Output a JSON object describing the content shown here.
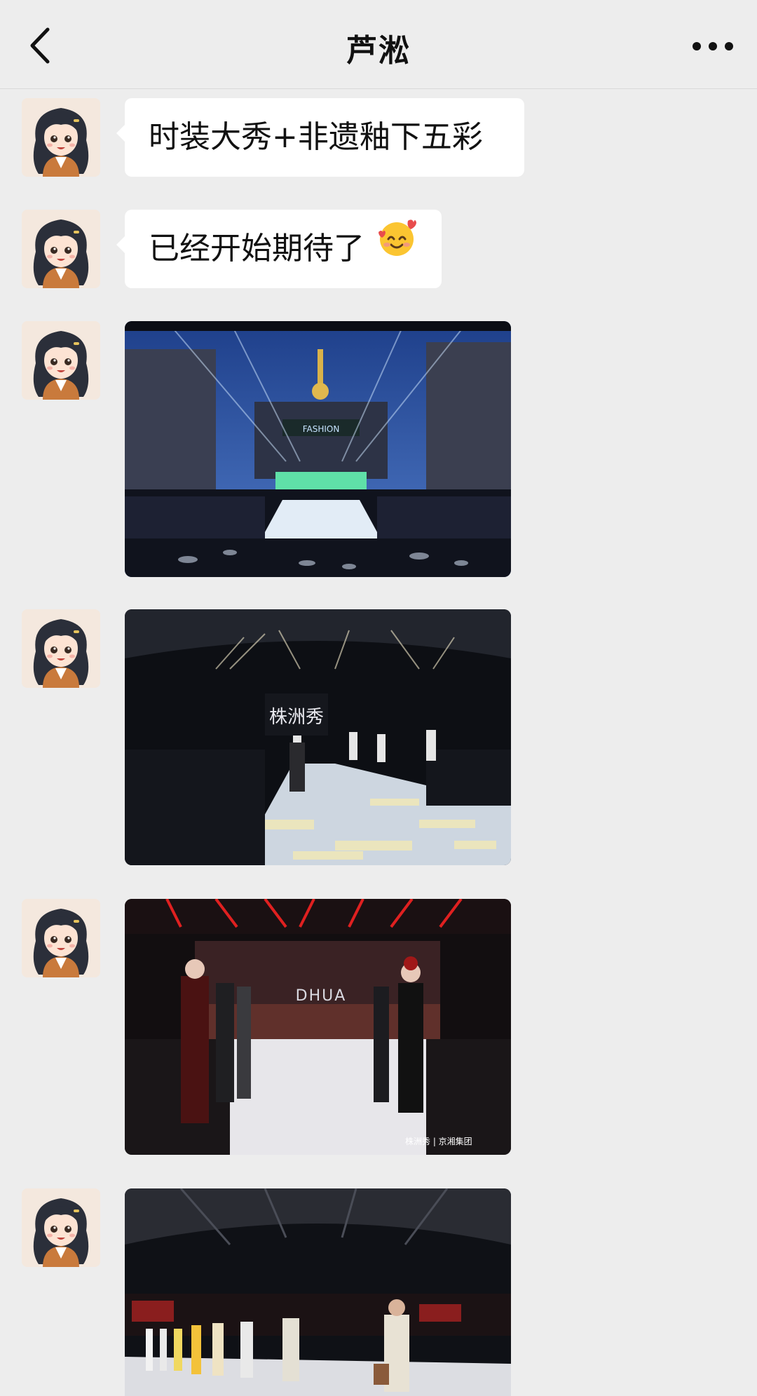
{
  "header": {
    "title": "芦淞"
  },
  "messages": {
    "text1": "时装大秀+非遗釉下五彩",
    "text2": "已经开始期待了",
    "photo1_sign": "FASHION",
    "photo2_sign": "株洲秀",
    "photo3_sign": "DHUA",
    "photo3_watermark": "株洲秀 | 京湘集团"
  },
  "icons": {
    "back": "chevron-left-icon",
    "more": "more-dots-icon",
    "emoji": "smiling-face-with-hearts-emoji"
  }
}
